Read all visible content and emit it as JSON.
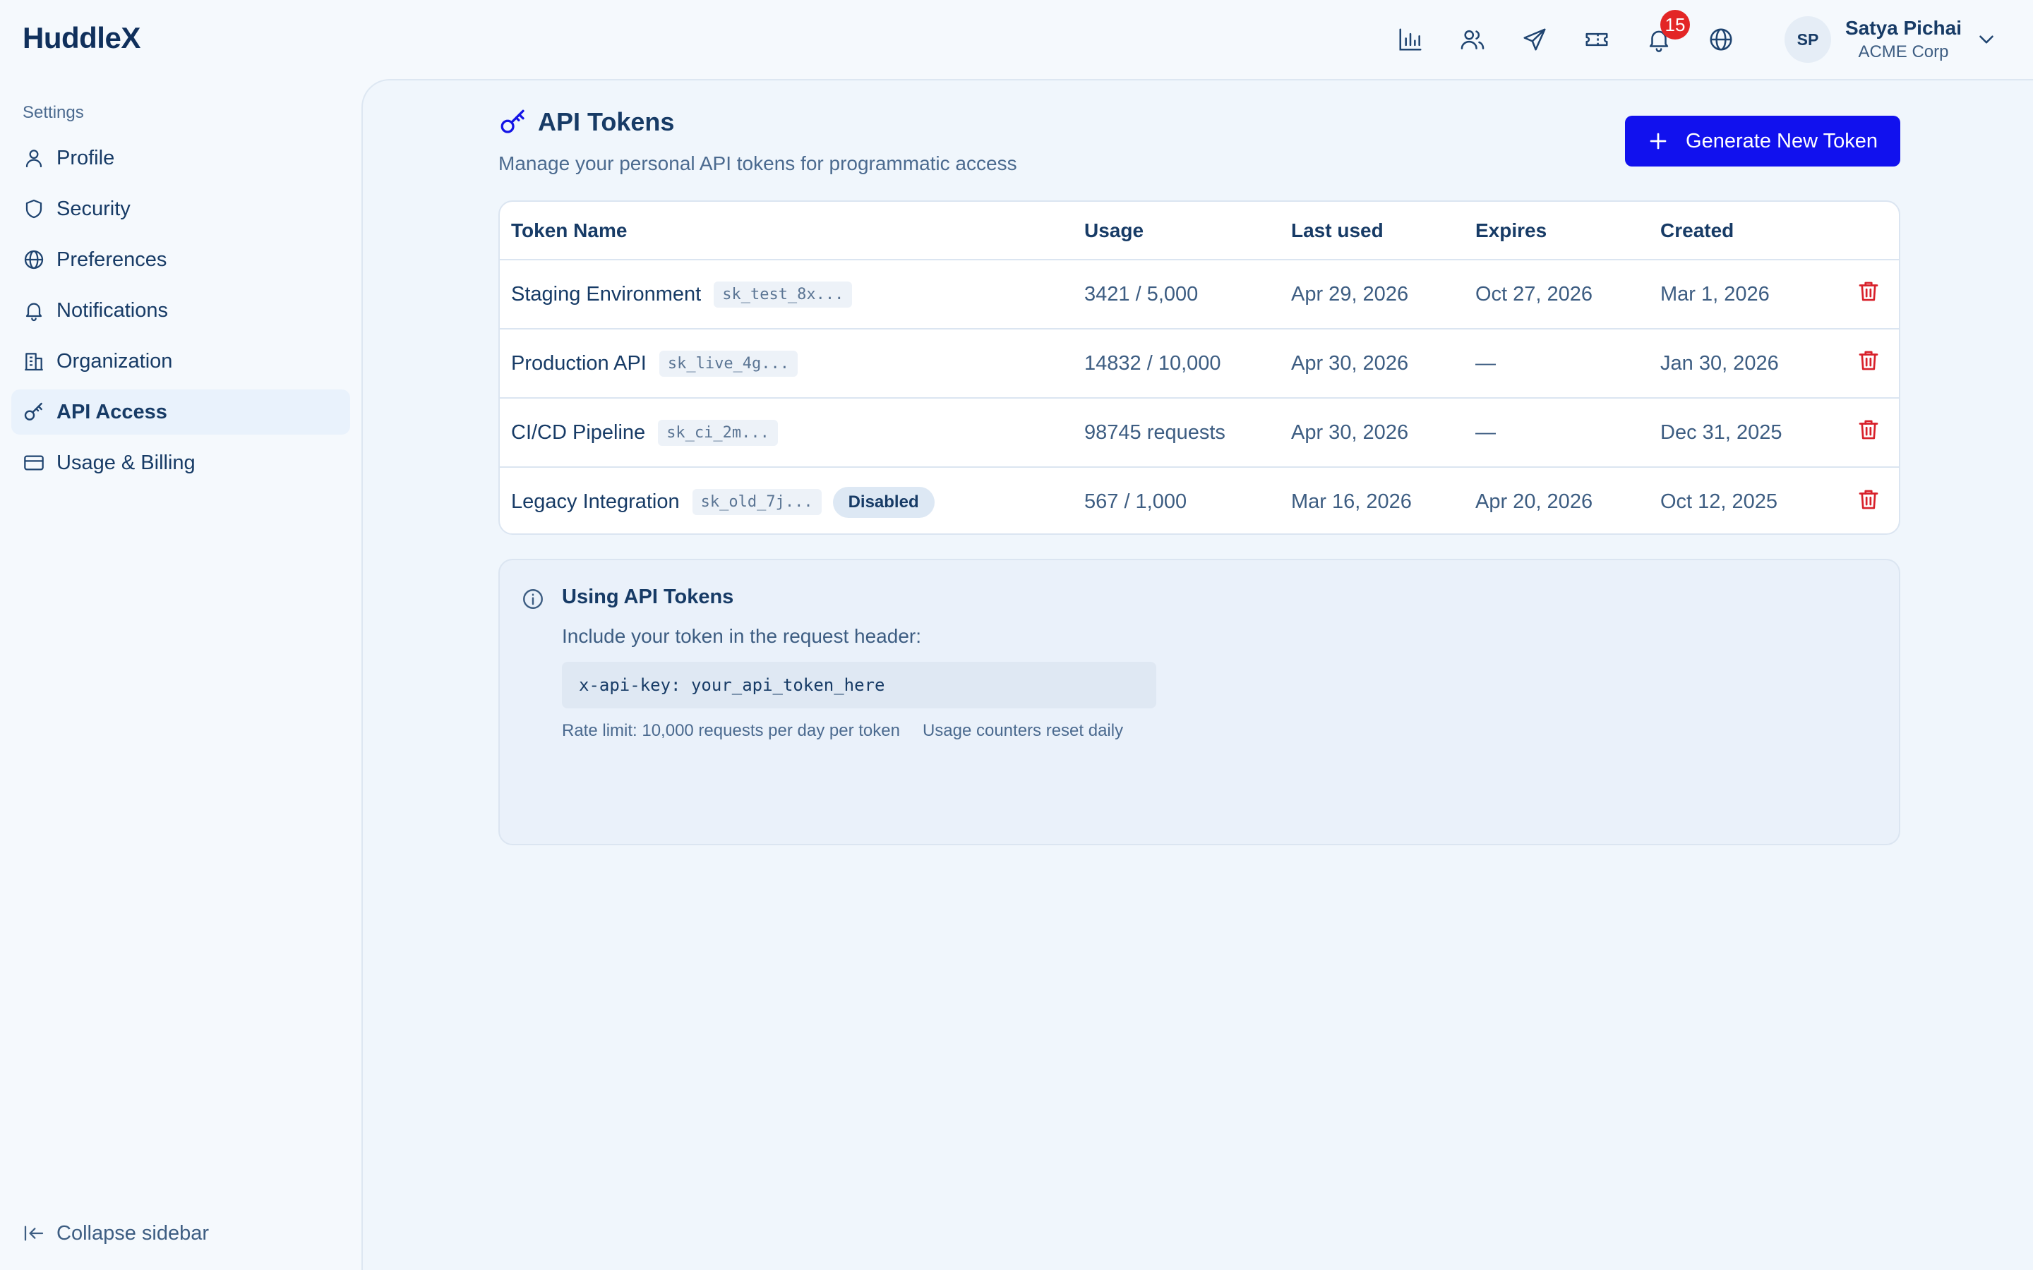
{
  "app": {
    "name": "HuddleX"
  },
  "header": {
    "icons": [
      "bar-chart-icon",
      "users-icon",
      "send-icon",
      "ticket-icon",
      "bell-icon",
      "globe-icon"
    ],
    "notification_count": "15",
    "user": {
      "initials": "SP",
      "name": "Satya Pichai",
      "org": "ACME Corp"
    }
  },
  "sidebar": {
    "section": "Settings",
    "items": [
      {
        "label": "Profile",
        "icon": "user-icon"
      },
      {
        "label": "Security",
        "icon": "shield-icon"
      },
      {
        "label": "Preferences",
        "icon": "globe-icon"
      },
      {
        "label": "Notifications",
        "icon": "bell-icon"
      },
      {
        "label": "Organization",
        "icon": "building-icon"
      },
      {
        "label": "API Access",
        "icon": "key-icon",
        "active": true
      },
      {
        "label": "Usage & Billing",
        "icon": "credit-card-icon"
      }
    ],
    "collapse_label": "Collapse sidebar"
  },
  "page": {
    "title": "API Tokens",
    "subtitle": "Manage your personal API tokens for programmatic access",
    "generate_button": "Generate New Token"
  },
  "table": {
    "columns": [
      "Token Name",
      "Usage",
      "Last used",
      "Expires",
      "Created"
    ],
    "rows": [
      {
        "name": "Staging Environment",
        "key": "sk_test_8x...",
        "status": "",
        "usage": "3421 / 5,000",
        "last_used": "Apr 29, 2026",
        "expires": "Oct 27, 2026",
        "created": "Mar 1, 2026"
      },
      {
        "name": "Production API",
        "key": "sk_live_4g...",
        "status": "",
        "usage": "14832 / 10,000",
        "last_used": "Apr 30, 2026",
        "expires": "—",
        "created": "Jan 30, 2026"
      },
      {
        "name": "CI/CD Pipeline",
        "key": "sk_ci_2m...",
        "status": "",
        "usage": "98745 requests",
        "last_used": "Apr 30, 2026",
        "expires": "—",
        "created": "Dec 31, 2025"
      },
      {
        "name": "Legacy Integration",
        "key": "sk_old_7j...",
        "status": "Disabled",
        "usage": "567 / 1,000",
        "last_used": "Mar 16, 2026",
        "expires": "Apr 20, 2026",
        "created": "Oct 12, 2025"
      }
    ]
  },
  "info": {
    "title": "Using API Tokens",
    "description": "Include your token in the request header:",
    "code": "x-api-key: your_api_token_here",
    "rate_limit": "Rate limit: 10,000 requests per day per token",
    "reset_note": "Usage counters reset daily"
  },
  "colors": {
    "primary": "#1111ee",
    "danger": "#d8202a",
    "text": "#173b66",
    "badge": "#e32626"
  }
}
